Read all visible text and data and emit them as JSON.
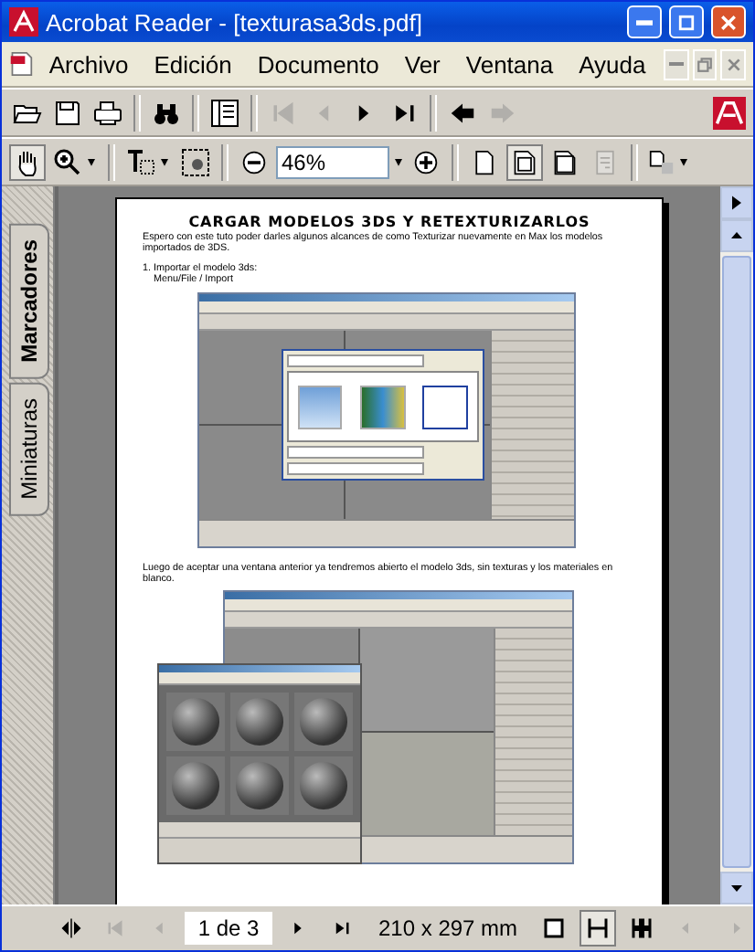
{
  "window": {
    "title": "Acrobat Reader - [texturasa3ds.pdf]"
  },
  "menu": [
    "Archivo",
    "Edición",
    "Documento",
    "Ver",
    "Ventana",
    "Ayuda"
  ],
  "zoom": {
    "value": "46%"
  },
  "view_buttons": [
    {
      "kind": "actual",
      "selected": false,
      "disabled": false
    },
    {
      "kind": "fitpage",
      "selected": true,
      "disabled": false
    },
    {
      "kind": "fitwidth",
      "selected": false,
      "disabled": false
    },
    {
      "kind": "reflow",
      "selected": false,
      "disabled": true
    }
  ],
  "side_tabs": [
    {
      "label": "Marcadores",
      "selected": true
    },
    {
      "label": "Miniaturas",
      "selected": false
    }
  ],
  "document": {
    "title": "CARGAR MODELOS 3DS Y RETEXTURIZARLOS",
    "intro": "Espero con este tuto poder darles algunos alcances de como Texturizar nuevamente en Max los modelos importados de 3DS.",
    "step": "1. Importar el modelo 3ds:",
    "substep": "Menu/File / Import",
    "after": "Luego de aceptar una ventana anterior ya tendremos abierto el modelo 3ds, sin texturas y los materiales en blanco."
  },
  "status_bar": {
    "page": "1 de 3",
    "size": "210 x 297 mm",
    "layouts": [
      {
        "kind": "single",
        "selected": false
      },
      {
        "kind": "continuous",
        "selected": true
      },
      {
        "kind": "facing",
        "selected": false
      }
    ]
  }
}
